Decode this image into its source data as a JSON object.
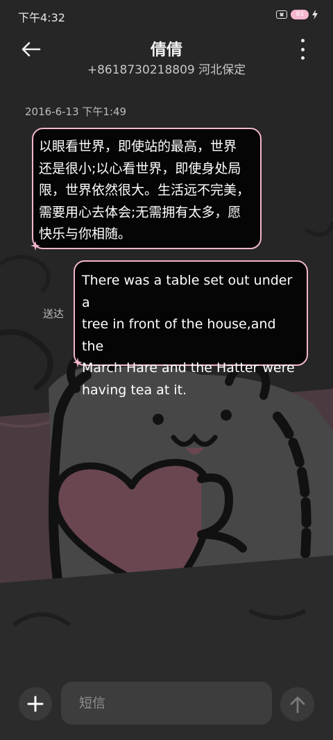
{
  "status_bar": {
    "time": "下午4:32",
    "battery_level": "93",
    "icons": [
      "no-sim-icon",
      "battery-icon",
      "charging-bolt-icon"
    ]
  },
  "header": {
    "contact_name": "倩倩",
    "contact_number": "+8618730218809 河北保定",
    "icons": [
      "back-arrow-icon",
      "more-vertical-icon"
    ]
  },
  "conversation": {
    "timestamp": "2016-6-13 下午1:49",
    "messages": [
      {
        "direction": "incoming",
        "lines": [
          "以眼看世界，即使站的最高，世界",
          "还是很小;以心看世界，即使身处局",
          "限，世界依然很大。生活远不完美，",
          "需要用心去体会;无需拥有太多，愿",
          "快乐与你相随。"
        ]
      },
      {
        "direction": "outgoing",
        "status": "送达",
        "lines": [
          "There was a table set out under a",
          "tree in front of the house,and the",
          "March Hare and the Hatter were",
          "having tea at it."
        ]
      }
    ]
  },
  "composer": {
    "placeholder": "短信",
    "value": "",
    "icons": [
      "plus-icon",
      "send-arrow-icon"
    ]
  },
  "colors": {
    "background": "#262626",
    "bubble_fill": "#050505",
    "bubble_border": "#f4b7cf",
    "wallpaper_heart": "#6a4650",
    "wallpaper_band": "#4b3a3f"
  }
}
